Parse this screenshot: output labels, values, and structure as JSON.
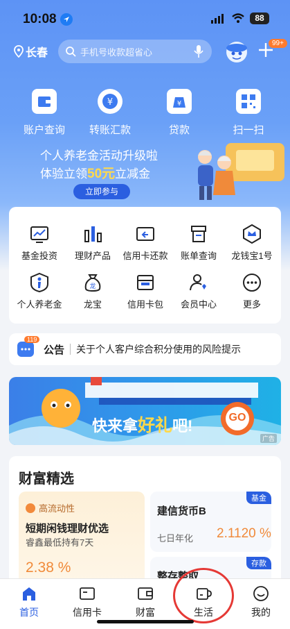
{
  "status_bar": {
    "time": "10:08",
    "battery": "88"
  },
  "header": {
    "city": "长春",
    "search_placeholder": "手机号收款超省心",
    "message_badge": "99+"
  },
  "top_functions": [
    {
      "label": "账户查询",
      "icon": "wallet-icon"
    },
    {
      "label": "转账汇款",
      "icon": "transfer-icon"
    },
    {
      "label": "贷款",
      "icon": "loan-bag-icon"
    },
    {
      "label": "扫一扫",
      "icon": "scan-icon"
    }
  ],
  "promo": {
    "line1": "个人养老金活动升级啦",
    "line2_prefix": "体验立领",
    "line2_amount": "50元",
    "line2_suffix": "立减金",
    "button": "立即参与"
  },
  "grid": [
    {
      "label": "基金投资",
      "icon": "fund-chart-icon"
    },
    {
      "label": "理财产品",
      "icon": "bar-chart-icon"
    },
    {
      "label": "信用卡还款",
      "icon": "credit-card-repay-icon"
    },
    {
      "label": "账单查询",
      "icon": "bill-icon"
    },
    {
      "label": "龙钱宝1号",
      "icon": "crown-shield-icon"
    },
    {
      "label": "个人养老金",
      "icon": "pension-icon"
    },
    {
      "label": "龙宝",
      "icon": "money-bag-icon"
    },
    {
      "label": "信用卡包",
      "icon": "card-wallet-icon"
    },
    {
      "label": "会员中心",
      "icon": "member-icon"
    },
    {
      "label": "更多",
      "icon": "more-icon"
    }
  ],
  "notice": {
    "badge": "119",
    "title": "公告",
    "text": "关于个人客户综合积分使用的风险提示"
  },
  "banner": {
    "text_prefix": "快来拿",
    "text_highlight": "好礼",
    "text_suffix": "吧!",
    "go": "GO",
    "ad_label": "广告"
  },
  "wealth": {
    "title": "财富精选",
    "left_card": {
      "tag": "高流动性",
      "name": "短期闲钱理财优选",
      "sub": "睿鑫最低持有7天",
      "rate": "2.38 %"
    },
    "right_card_1": {
      "tag": "基金",
      "name": "建信货币B",
      "label": "七日年化",
      "rate": "2.1120 %"
    },
    "right_card_2": {
      "tag": "存款",
      "name": "整存整取"
    }
  },
  "tabs": [
    {
      "label": "首页",
      "icon": "home-icon",
      "active": true
    },
    {
      "label": "信用卡",
      "icon": "credit-card-icon",
      "active": false
    },
    {
      "label": "财富",
      "icon": "wealth-wallet-icon",
      "active": false
    },
    {
      "label": "生活",
      "icon": "cup-icon",
      "active": false
    },
    {
      "label": "我的",
      "icon": "smile-icon",
      "active": false
    }
  ],
  "colors": {
    "primary": "#2b5fe0",
    "accent_orange": "#f08a3a",
    "hero_blue": "#5d93f5"
  }
}
